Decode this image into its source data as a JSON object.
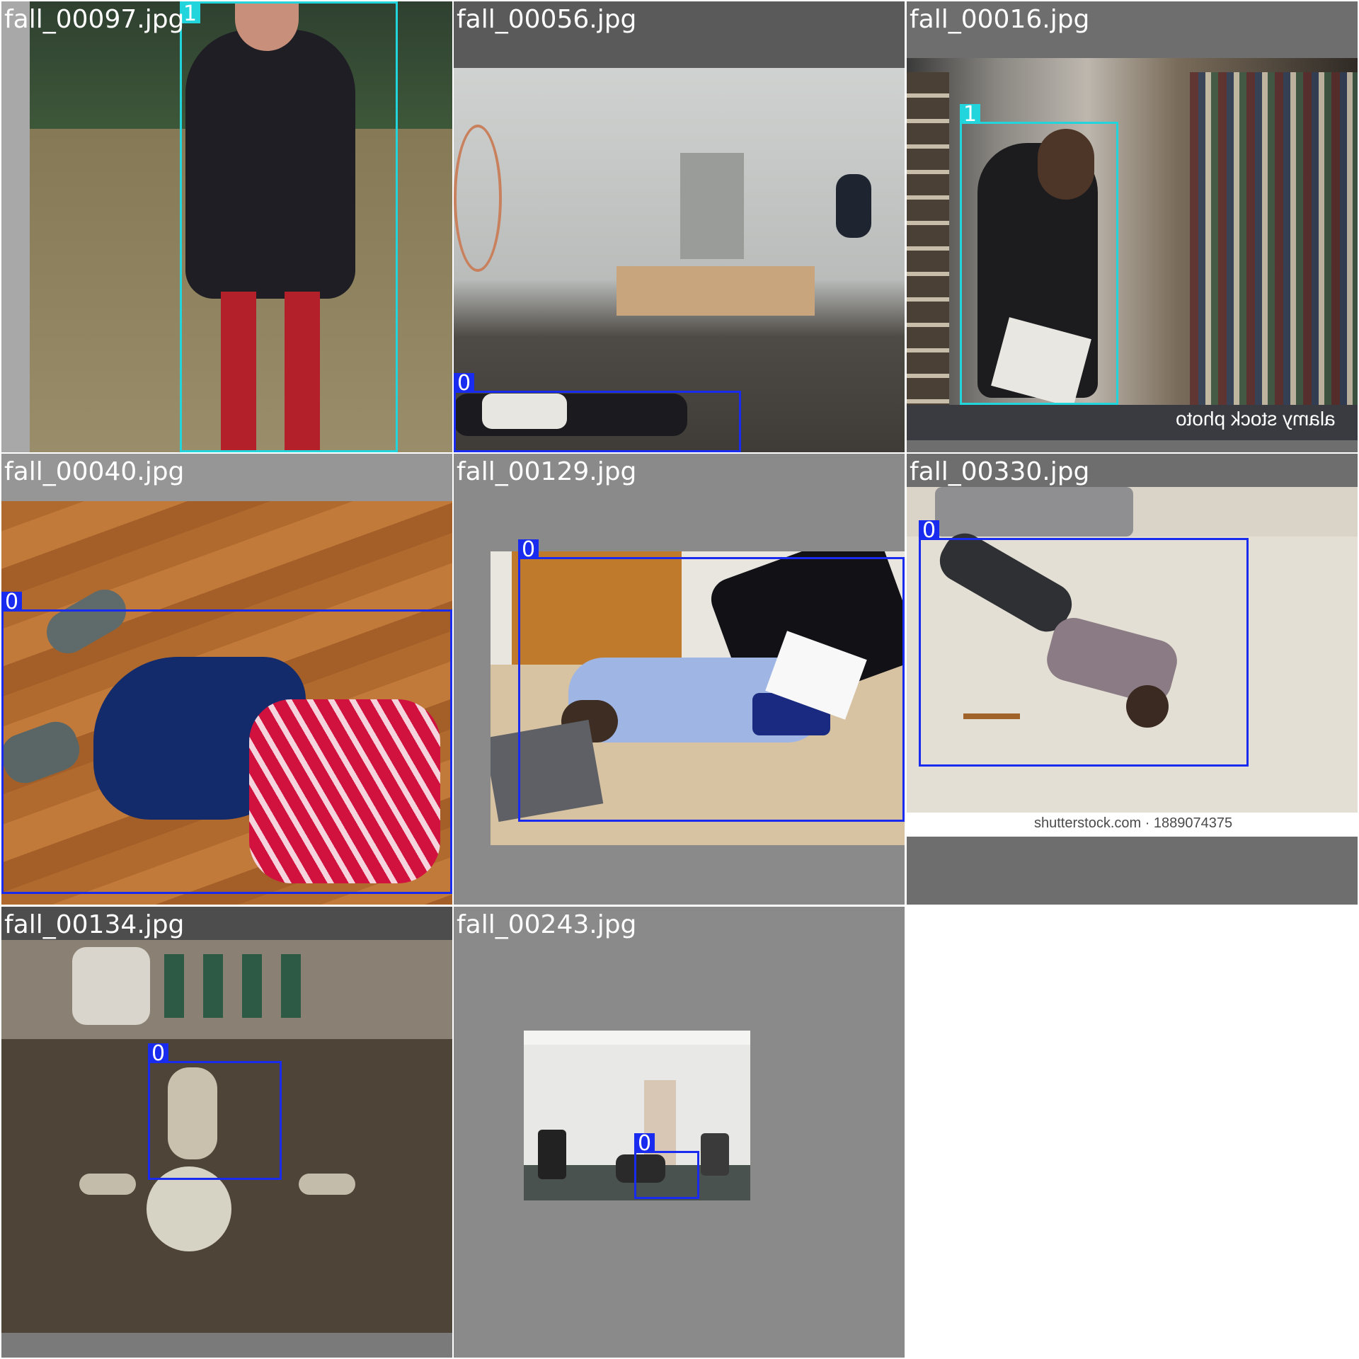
{
  "tiles": [
    {
      "filename": "fall_00097.jpg",
      "boxes": [
        {
          "class": "1"
        }
      ]
    },
    {
      "filename": "fall_00056.jpg",
      "boxes": [
        {
          "class": "0"
        }
      ]
    },
    {
      "filename": "fall_00016.jpg",
      "boxes": [
        {
          "class": "1"
        }
      ],
      "watermark": "alamy stock photo"
    },
    {
      "filename": "fall_00040.jpg",
      "boxes": [
        {
          "class": "0"
        }
      ]
    },
    {
      "filename": "fall_00129.jpg",
      "boxes": [
        {
          "class": "0"
        }
      ]
    },
    {
      "filename": "fall_00330.jpg",
      "boxes": [
        {
          "class": "0"
        }
      ],
      "caption": "shutterstock.com · 1889074375"
    },
    {
      "filename": "fall_00134.jpg",
      "boxes": [
        {
          "class": "0"
        }
      ]
    },
    {
      "filename": "fall_00243.jpg",
      "boxes": [
        {
          "class": "0"
        }
      ]
    }
  ],
  "colors": {
    "class_0": "#1a2bf0",
    "class_1": "#22d4dc",
    "tile_background": "#8a8a8a"
  }
}
